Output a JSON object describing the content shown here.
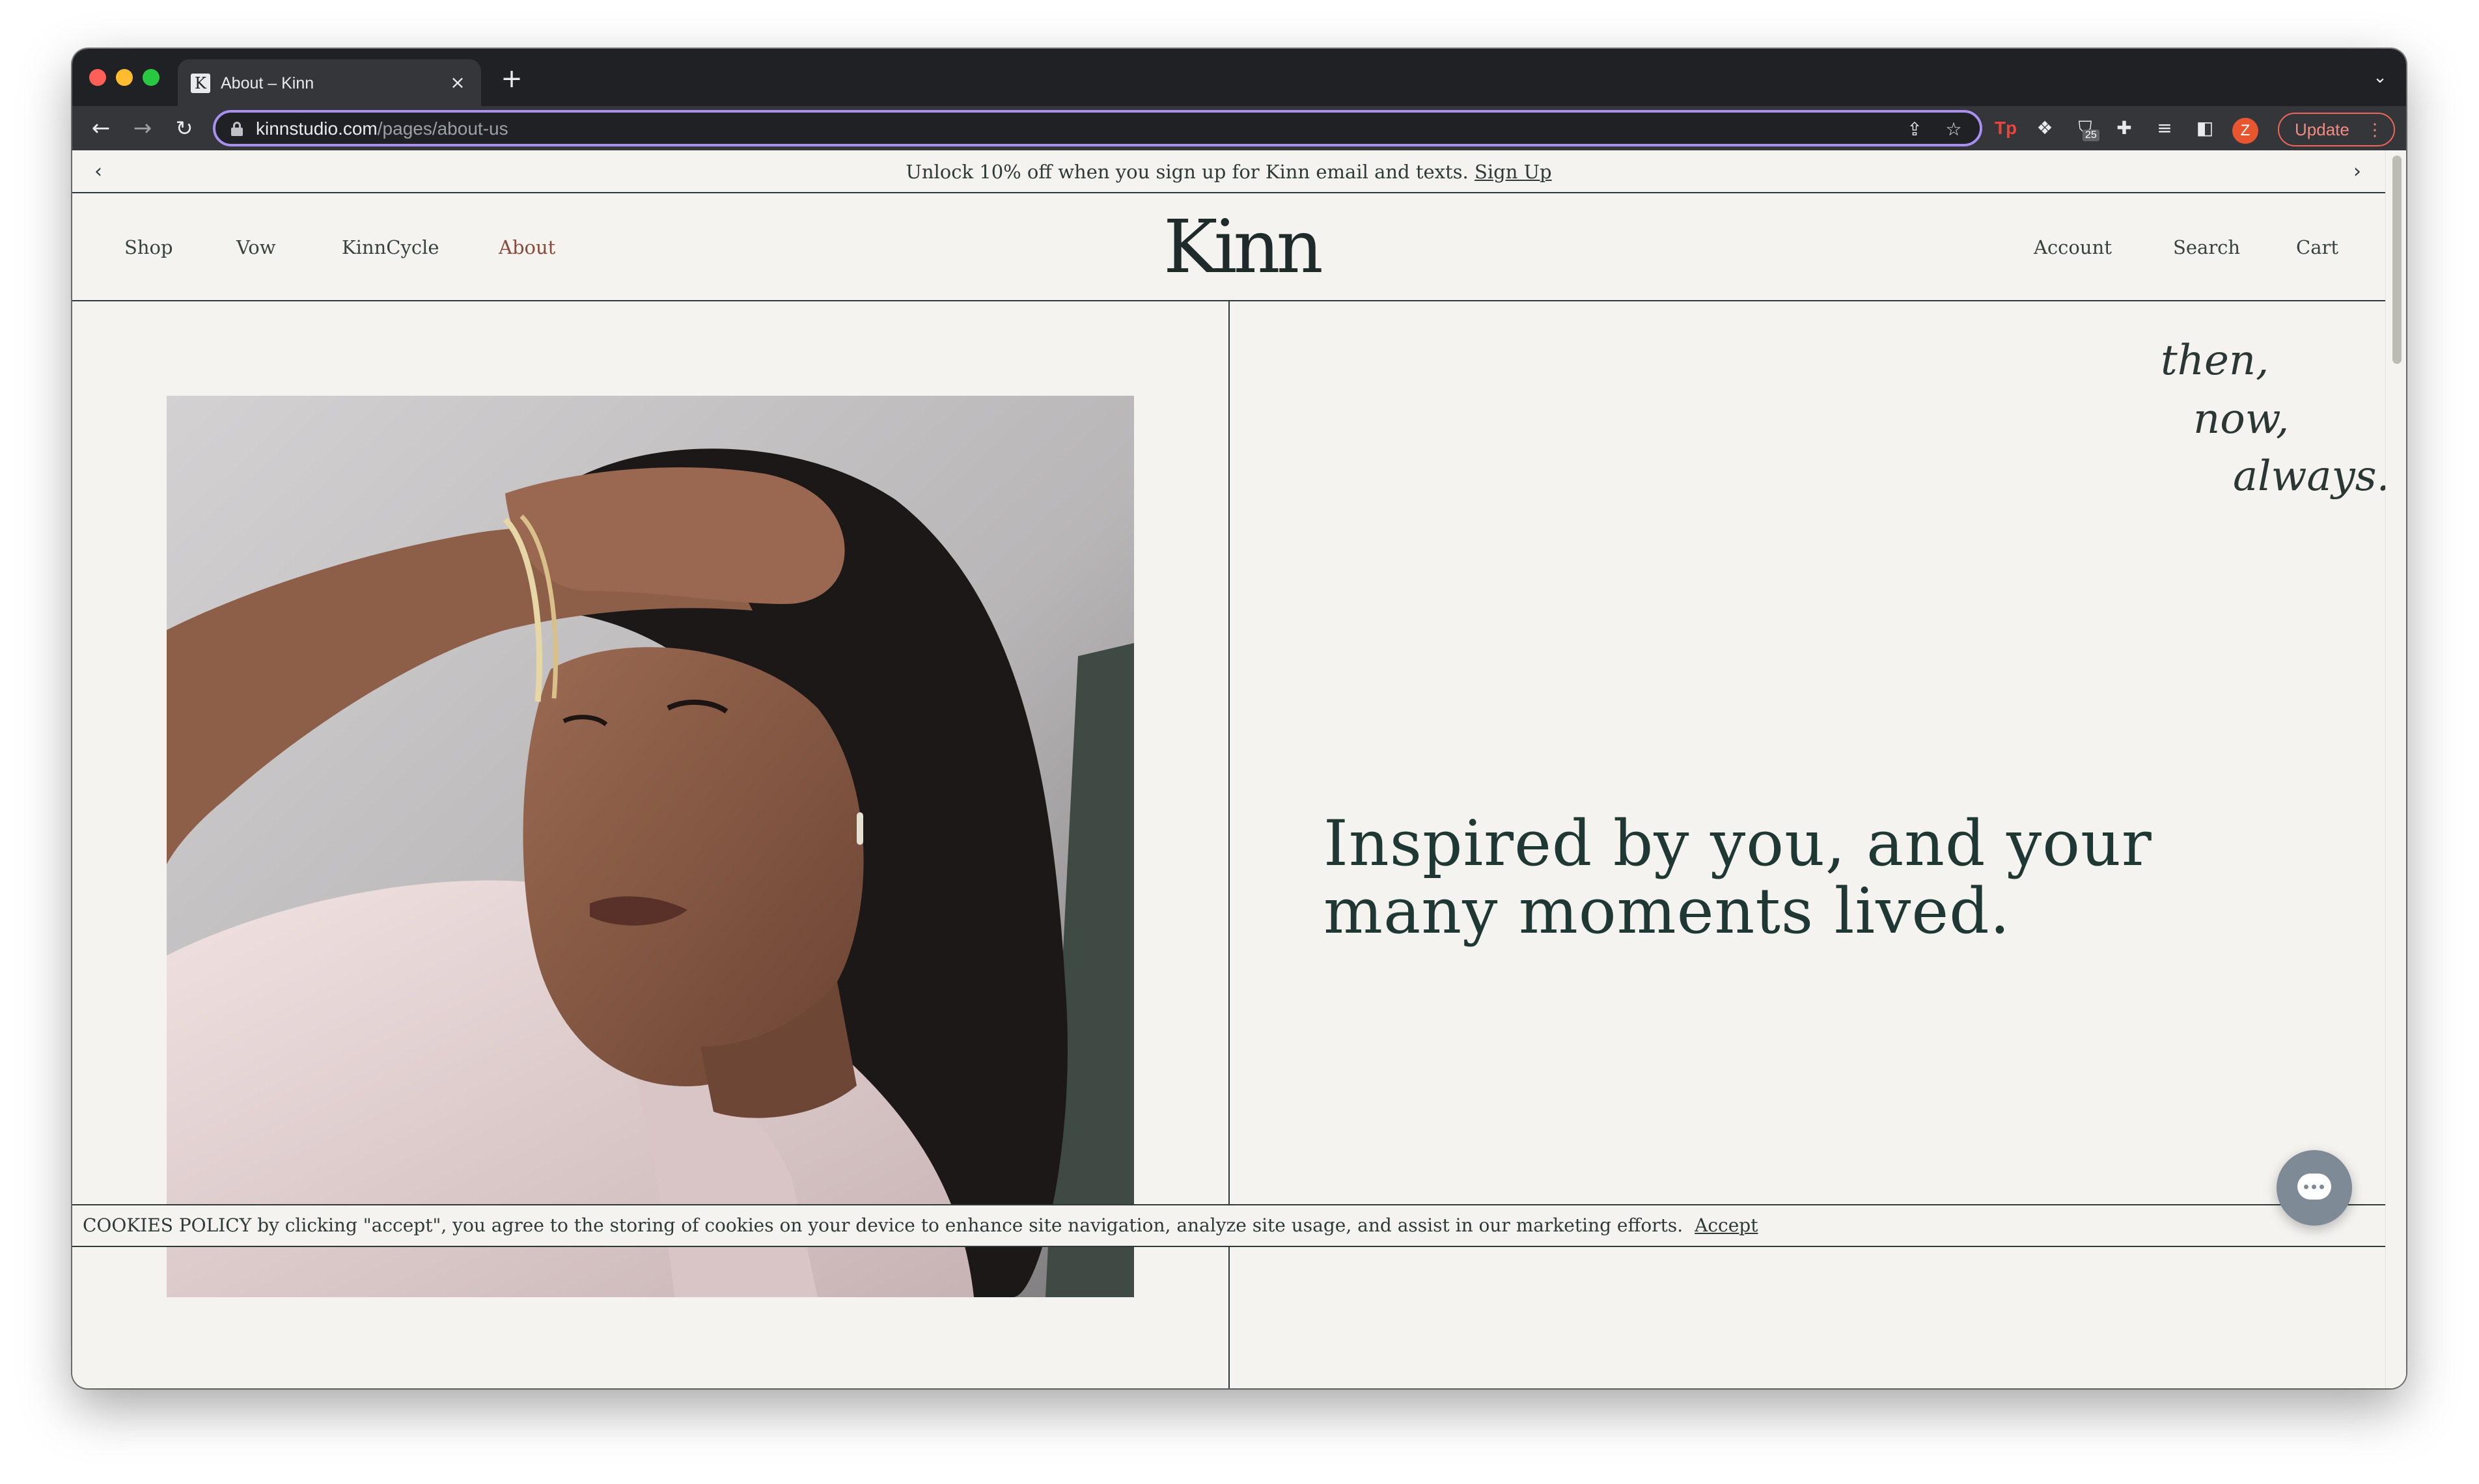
{
  "browser": {
    "tab_title": "About – Kinn",
    "tab_favicon_letter": "K",
    "new_tab_symbol": "+",
    "url_host": "kinnstudio.com",
    "url_path": "/pages/about-us",
    "update_label": "Update",
    "profile_initial": "Z",
    "extension_badge": "25",
    "extension_tp_label": "Tp",
    "icons": [
      "back-arrow-icon",
      "forward-arrow-icon",
      "reload-icon",
      "lock-icon",
      "share-icon",
      "star-icon",
      "extensions-puzzle-icon",
      "media-queue-icon",
      "side-panel-icon",
      "more-vert-icon"
    ],
    "accent_color": "#a990f0"
  },
  "announcement": {
    "text": "Unlock 10% off when you sign up for Kinn email and texts.",
    "link": "Sign Up",
    "prev_symbol": "‹",
    "next_symbol": "›"
  },
  "header": {
    "nav_left": [
      "Shop",
      "Vow",
      "KinnCycle",
      "About"
    ],
    "active_item": "About",
    "logo": "Kinn",
    "nav_right": [
      "Account",
      "Search",
      "Cart"
    ],
    "active_color": "#8a4b3c"
  },
  "hero": {
    "tagline": [
      "then,",
      "now,",
      "always."
    ],
    "headline": "Inspired by you, and your many moments lived."
  },
  "cookie_bar": {
    "text": "COOKIES POLICY by clicking \"accept\", you agree to the storing of cookies on your device to enhance site navigation, analyze site usage, and assist in our marketing efforts.",
    "accept": "Accept"
  },
  "chat": {
    "icon": "chat-bubble-icon"
  }
}
